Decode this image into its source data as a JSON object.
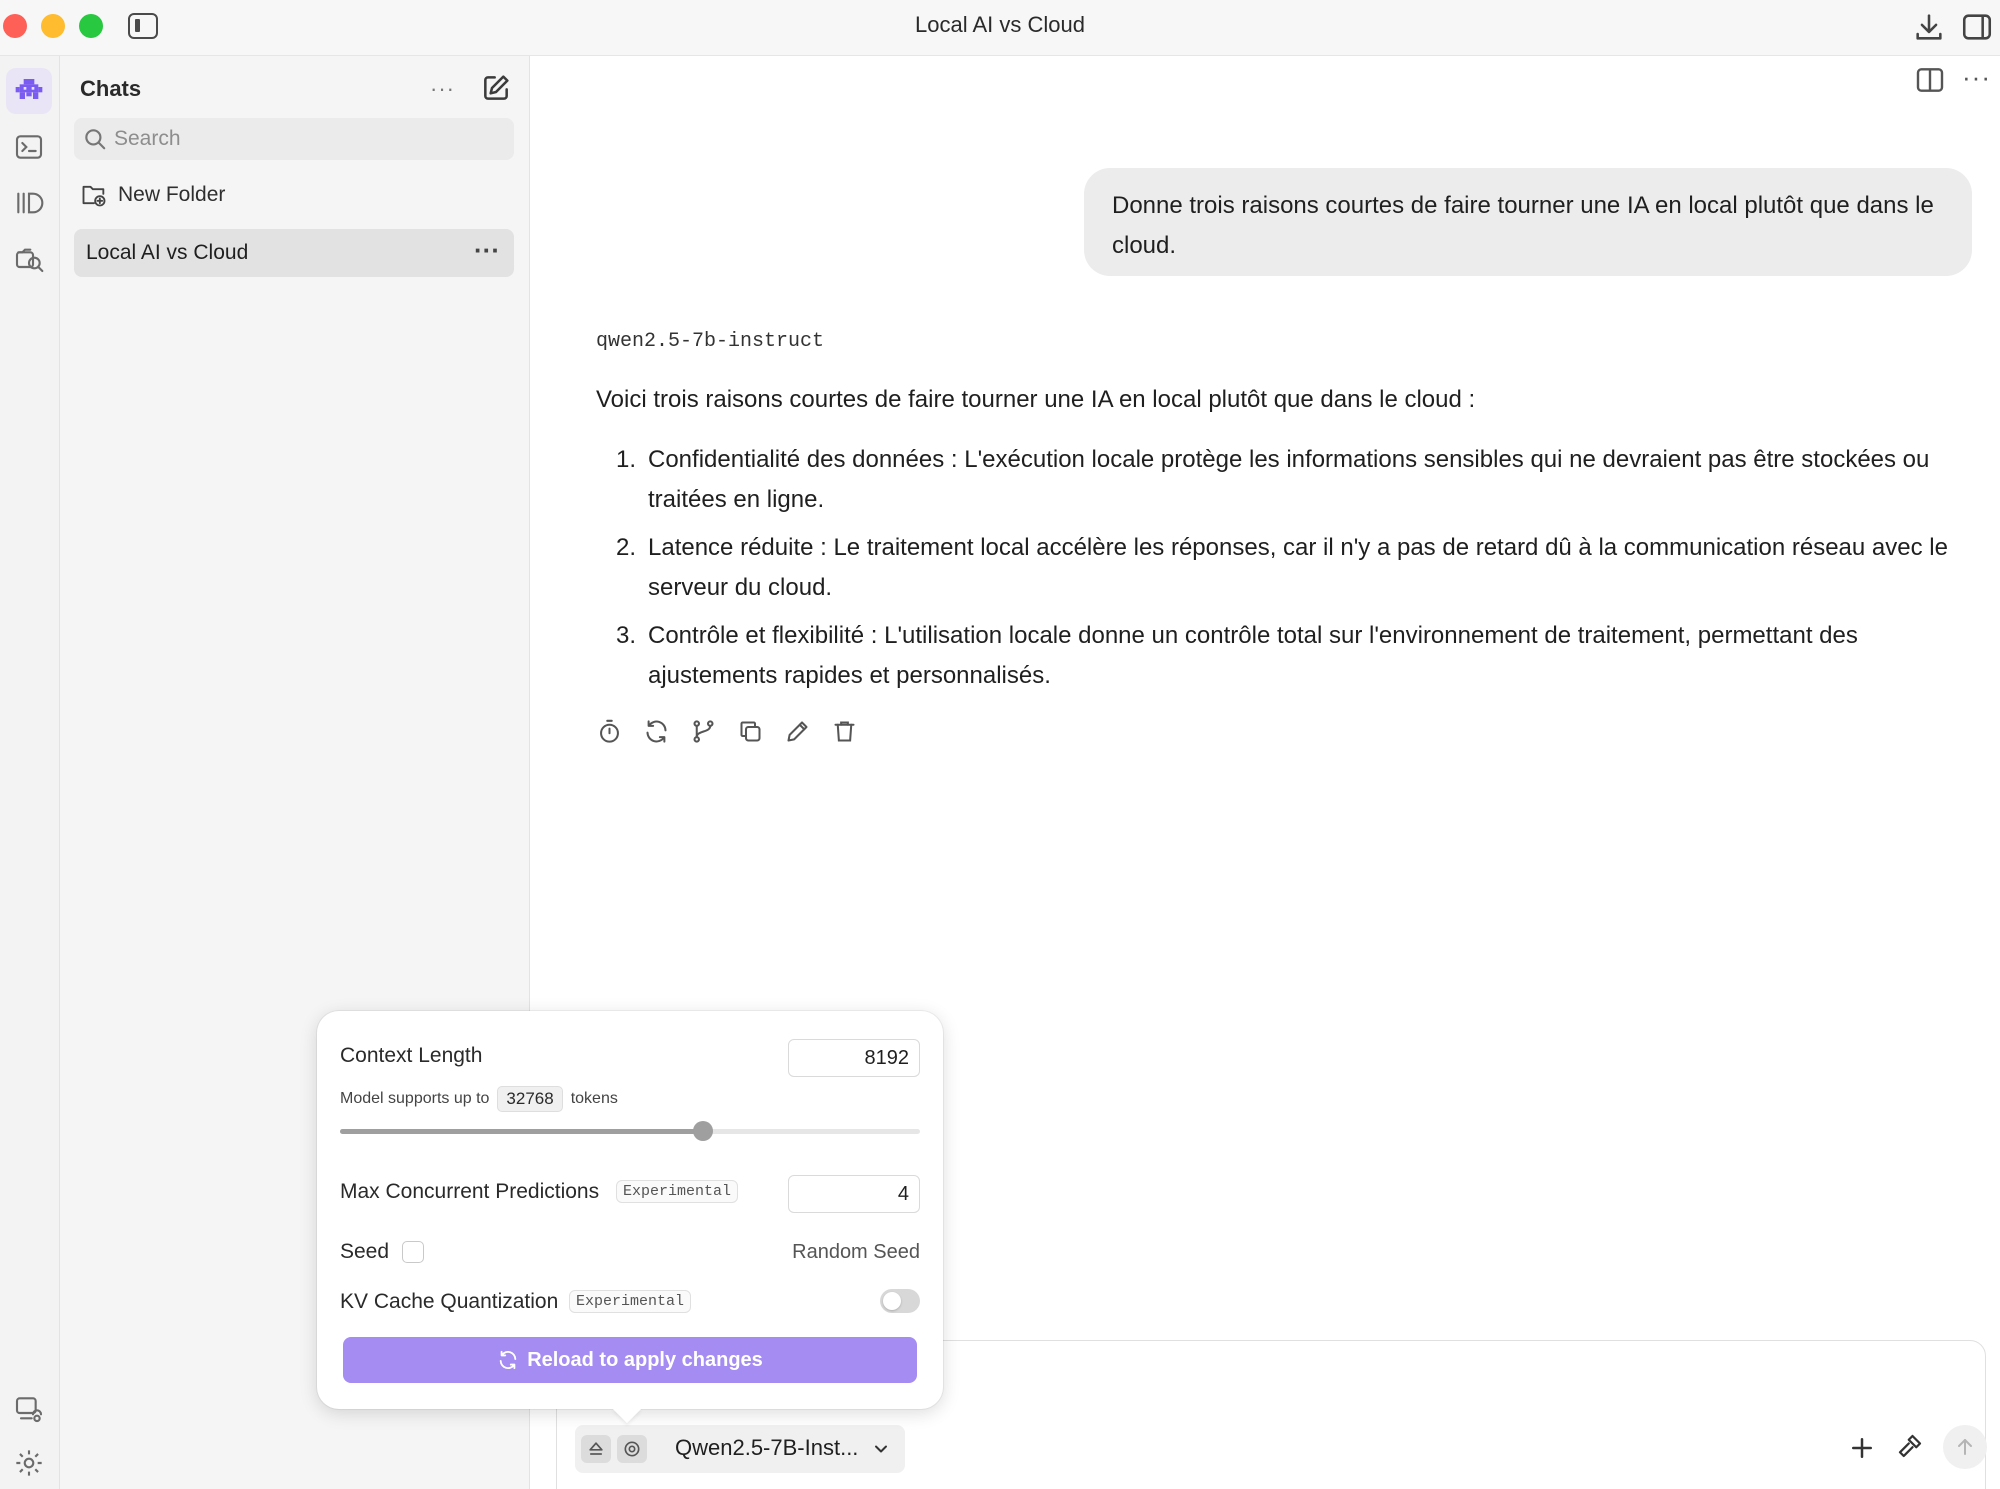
{
  "window": {
    "title": "Local AI vs Cloud"
  },
  "sidebar": {
    "title": "Chats",
    "more_label": "···",
    "search_placeholder": "Search",
    "new_folder_label": "New Folder",
    "chats": [
      {
        "label": "Local AI vs Cloud",
        "selected": true
      }
    ],
    "chat_menu_label": "···"
  },
  "conversation": {
    "user_message": "Donne trois raisons courtes de faire tourner une IA en local plutôt que dans le cloud.",
    "model_name": "qwen2.5-7b-instruct",
    "answer_intro": "Voici trois raisons courtes de faire tourner une IA en local plutôt que dans le cloud :",
    "answer_items": [
      {
        "num": "1.",
        "text": "Confidentialité des données : L'exécution locale protège les informations sensibles qui ne devraient pas être stockées ou traitées en ligne."
      },
      {
        "num": "2.",
        "text": "Latence réduite : Le traitement local accélère les réponses, car il n'y a pas de retard dû à la communication réseau avec le serveur du cloud."
      },
      {
        "num": "3.",
        "text": "Contrôle et flexibilité : L'utilisation locale donne un contrôle total sur l'environnement de traitement, permettant des ajustements rapides et personnalisés."
      }
    ],
    "main_more_label": "···"
  },
  "settings_popover": {
    "context_length_label": "Context Length",
    "context_length_value": "8192",
    "supports_prefix": "Model supports up to",
    "supports_value": "32768",
    "supports_suffix": "tokens",
    "slider_fraction": 0.625,
    "max_predictions_label": "Max Concurrent Predictions",
    "experimental_badge": "Experimental",
    "max_predictions_value": "4",
    "seed_label": "Seed",
    "seed_checked": false,
    "random_seed_label": "Random Seed",
    "kv_cache_label": "KV Cache Quantization",
    "kv_cache_enabled": false,
    "reload_button_label": "Reload to apply changes",
    "accent_color": "#a48cf2"
  },
  "input_bar": {
    "model_chip_label": "Qwen2.5-7B-Inst..."
  }
}
